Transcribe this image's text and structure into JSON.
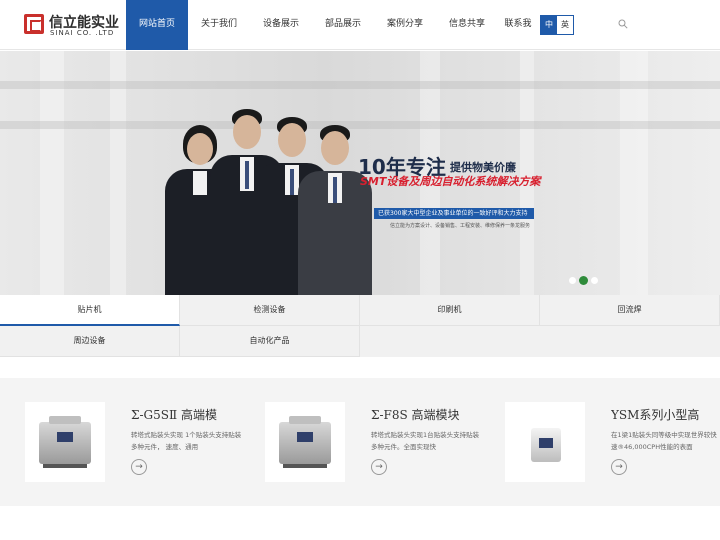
{
  "header": {
    "logo": {
      "cn": "信立能实业",
      "en": "SINAI CO. .LTD"
    },
    "nav": [
      {
        "label": "网站首页",
        "active": true
      },
      {
        "label": "关于我们",
        "active": false
      },
      {
        "label": "设备展示",
        "active": false
      },
      {
        "label": "部品展示",
        "active": false
      },
      {
        "label": "案例分享",
        "active": false
      },
      {
        "label": "信息共享",
        "active": false
      },
      {
        "label": "联系我",
        "active": false
      }
    ],
    "lang": {
      "zh": "中",
      "en": "英"
    },
    "icons": {
      "search": "search-icon"
    },
    "colors": {
      "primary": "#1f5aa9",
      "accent_red": "#d8202f"
    }
  },
  "banner": {
    "headline": "10年专注",
    "headline_sub": "提供物美价廉",
    "slogan": "SMT设备及周边自动化系统解决方案",
    "tagline": "已获300家大中型企业及事业单位的一致好评和大力支持",
    "tagline_2": "信立能为方案设计、设备销售、工程安装、维修保养一条龙服务",
    "slides": 3,
    "active_slide": 2
  },
  "categories": {
    "row1": [
      "贴片机",
      "检测设备",
      "印刷机",
      "回流焊"
    ],
    "row2": [
      "周边设备",
      "自动化产品"
    ],
    "active": "贴片机"
  },
  "products": [
    {
      "title": "Σ-G5SⅡ 高端模",
      "desc": "转塔式贴装头实现 1个贴装头支持贴装多种元件， 速度、通用",
      "more": "→"
    },
    {
      "title": "Σ-F8S 高端模块",
      "desc": "转塔式贴装头实现1台贴装头支持贴装多种元件。全面实现快",
      "more": "→"
    },
    {
      "title": "YSM系列小型高",
      "desc": "在1梁1贴装头同等级中实现世界较快速®46,000CPH性能的表面",
      "more": "→"
    }
  ]
}
